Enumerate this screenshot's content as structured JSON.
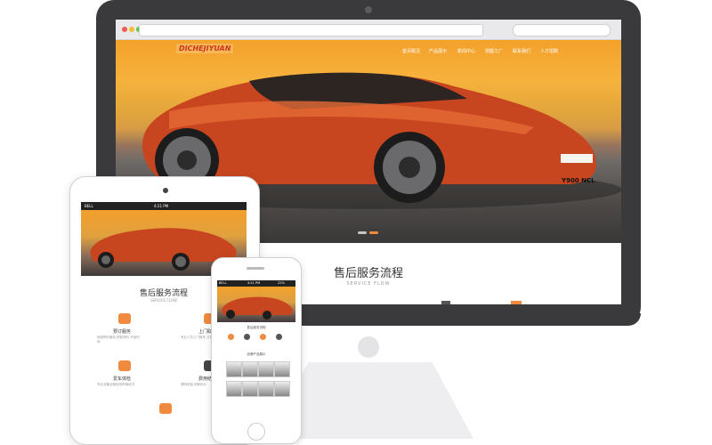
{
  "colors": {
    "accent": "#ef8a3f",
    "monitor": "#3a3a3c",
    "brand_red": "#c9381e"
  },
  "desktop": {
    "logo": "DICHEJIYUAN",
    "nav": [
      "首页概况",
      "产品展示",
      "新闻中心",
      "把握工厂",
      "联系我们",
      "人才招聘"
    ],
    "plate": "Y900 NCL",
    "section_title": "售后服务流程",
    "section_subtitle": "SERVICE FLOW"
  },
  "tablet": {
    "status_time": "4:21 PM",
    "status_carrier": "BELL",
    "section_title": "售后服务流程",
    "section_subtitle": "SERVICE FLOW",
    "steps": [
      {
        "label": "预订服务",
        "text": "网络预约服务,提前预约,节省时间"
      },
      {
        "label": "上门取车",
        "text": "专业人员上门取车,方便快捷"
      },
      {
        "label": "爱车体检",
        "text": "专业设备全面检测车辆状况"
      },
      {
        "label": "费用结算",
        "text": "透明收费,明码标价"
      }
    ],
    "icons": [
      "chat-icon",
      "car-icon",
      "laptop-icon",
      "wrench-icon",
      "clipboard-icon"
    ]
  },
  "phone": {
    "status_time": "4:21 PM",
    "status_carrier": "BELL",
    "status_battery": "22%",
    "section1": "售后服务流程",
    "section2": "品牌产品展示"
  }
}
